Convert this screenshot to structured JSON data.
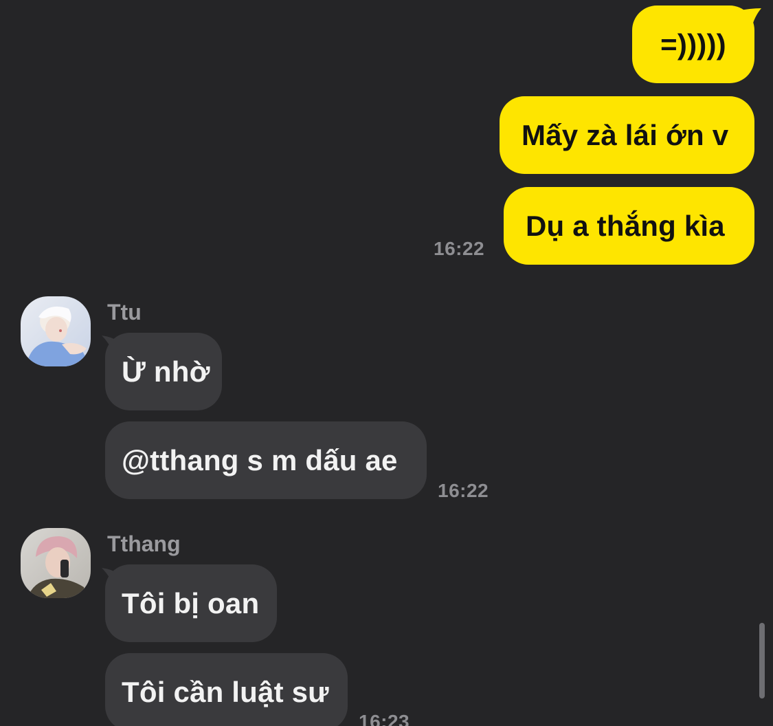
{
  "colors": {
    "background": "#252527",
    "outgoing_bubble": "#FEE500",
    "incoming_bubble": "#3A3A3D",
    "timestamp": "#8E8E92"
  },
  "messages_out": [
    {
      "text": "=)))))"
    },
    {
      "text": "Mấy zà lái ớn v"
    },
    {
      "text": "Dụ a thắng kìa"
    }
  ],
  "out_time": "16:22",
  "groups": [
    {
      "sender": "Ttu",
      "avatar": "avatar-ttu",
      "messages": [
        {
          "text": "Ừ nhờ"
        },
        {
          "text": "@tthang s m dấu ae"
        }
      ],
      "time": "16:22"
    },
    {
      "sender": "Tthang",
      "avatar": "avatar-tthang",
      "messages": [
        {
          "text": "Tôi bị oan"
        },
        {
          "text": "Tôi cần luật sư"
        }
      ],
      "time": "16:23"
    }
  ]
}
